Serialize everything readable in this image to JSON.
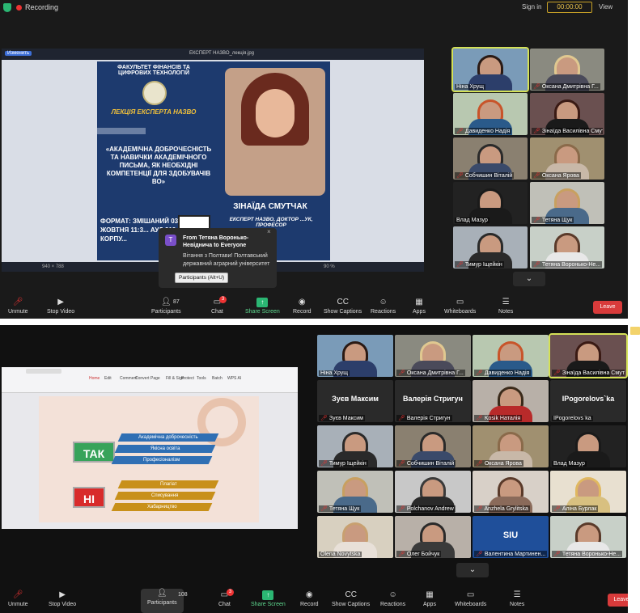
{
  "top": {
    "recording": "Recording",
    "signin": "Sign in",
    "timer": "00:00:00",
    "view": "View"
  },
  "viewer": {
    "filename": "ЕКСПЕРТ НАЗВО_лекція.jpg",
    "edit_button": "Изменить",
    "zoom": "90 %",
    "size_info": "940 × 788"
  },
  "poster": {
    "faculty": "ФАКУЛЬТЕТ ФІНАНСІВ ТА ЦИФРОВИХ ТЕХНОЛОГІЙ",
    "lecture": "ЛЕКЦІЯ ЕКСПЕРТА НАЗВО",
    "title": "«АКАДЕМІЧНА ДОБРОЧЕСНІСТЬ ТА НАВИЧКИ АКАДЕМІЧНОГО ПИСЬМА, ЯК НЕОБХІДНІ КОМПЕТЕНЦІЇ ДЛЯ ЗДОБУВАЧІВ ВО»",
    "speaker": "ЗІНАЇДА СМУТЧАК",
    "expert": "ЕКСПЕРТ НАЗВО, ДОКТОР ...УК, ПРОФЕСОР",
    "format": "ФОРМАТ: ЗМІШАНИЙ 03 ЖОВТНЯ 11:3... АУД 312, КОРПУ..."
  },
  "chat_popup": {
    "avatar": "T",
    "from": "From Тетяна Воронько-Невіднича to Everyone",
    "message": "Вітання з Полтави! Полтавський державний аграрний університет"
  },
  "gallery1": [
    {
      "name": "Ніна Хрущ",
      "muted": false,
      "hair": "#2a1a14",
      "body": "#2c3e6a",
      "bg": "#7a9bb8"
    },
    {
      "name": "Оксана Дмитрівна Г...",
      "muted": true,
      "hair": "#e0c890",
      "body": "#4a4a5a",
      "bg": "#8a8a80"
    },
    {
      "name": "Давиденко Надія",
      "muted": true,
      "hair": "#c8542a",
      "body": "#2a5a8a",
      "bg": "#b8c8b0"
    },
    {
      "name": "Зінаїда Василівна Смутч...",
      "muted": true,
      "hair": "#3a1a14",
      "body": "#1a1a1a",
      "bg": "#6a5050"
    },
    {
      "name": "Собчишин Віталій",
      "muted": true,
      "hair": "#2a2a2a",
      "body": "#3a4a6a",
      "bg": "#8a8070"
    },
    {
      "name": "Оксана Ярова",
      "muted": true,
      "hair": "#8a6a4a",
      "body": "#c8b8a8",
      "bg": "#a09070"
    },
    {
      "name": "Влад Мазур",
      "muted": false,
      "hair": "#1a1a1a",
      "body": "#1a1a1a",
      "bg": "#222222"
    },
    {
      "name": "Тетяна Щук",
      "muted": true,
      "hair": "#c8a060",
      "body": "#4a6a8a",
      "bg": "#c0c0b8"
    },
    {
      "name": "Тимур Іщейкін",
      "muted": true,
      "hair": "#2a2a2a",
      "body": "#2a2a2a",
      "bg": "#a8b0b8"
    },
    {
      "name": "Тетяна Воронько-Не...",
      "muted": true,
      "hair": "#5a3a2a",
      "body": "#e8e8e8",
      "bg": "#c8d0c8"
    }
  ],
  "gallery2": [
    {
      "name": "Ніна Хрущ",
      "muted": false,
      "hair": "#2a1a14",
      "body": "#2c3e6a",
      "bg": "#7a9bb8"
    },
    {
      "name": "Оксана Дмитрівна Г...",
      "muted": true,
      "hair": "#e0c890",
      "body": "#4a4a5a",
      "bg": "#8a8a80"
    },
    {
      "name": "Давиденко Надія",
      "muted": true,
      "hair": "#c8542a",
      "body": "#2a5a8a",
      "bg": "#b8c8b0"
    },
    {
      "name": "Зінаїда Василівна Смутч...",
      "muted": true,
      "hair": "#3a1a14",
      "body": "#1a1a1a",
      "bg": "#6a5050",
      "selected": true
    },
    {
      "name": "Зуєв Максим",
      "muted": true,
      "big": "Зуєв Максим"
    },
    {
      "name": "Валерія Стригун",
      "muted": true,
      "big": "Валерія Стригун"
    },
    {
      "name": "Kosik Наталія",
      "muted": true,
      "hair": "#3a2a1a",
      "body": "#b82a2a",
      "bg": "#b8b0a8"
    },
    {
      "name": "IPogorelovs`ka",
      "muted": false,
      "big": "IPogorelovs`ka"
    },
    {
      "name": "Тимур Іщейкін",
      "muted": true,
      "hair": "#2a2a2a",
      "body": "#2a2a2a",
      "bg": "#a8b0b8"
    },
    {
      "name": "Собчишин Віталій",
      "muted": true,
      "hair": "#2a2a2a",
      "body": "#3a4a6a",
      "bg": "#8a8070"
    },
    {
      "name": "Оксана Ярова",
      "muted": true,
      "hair": "#8a6a4a",
      "body": "#c8b8a8",
      "bg": "#a09070"
    },
    {
      "name": "Влад Мазур",
      "muted": false,
      "hair": "#1a1a1a",
      "body": "#1a1a1a",
      "bg": "#222222"
    },
    {
      "name": "Тетяна Щук",
      "muted": true,
      "hair": "#c8a060",
      "body": "#4a6a8a",
      "bg": "#c0c0b8"
    },
    {
      "name": "Polchanov Andrew",
      "muted": true,
      "hair": "#3a3a3a",
      "body": "#2a2a2a",
      "bg": "#c8c8c8"
    },
    {
      "name": "Anzhela Grylitska",
      "muted": true,
      "hair": "#5a3a2a",
      "body": "#8a6a5a",
      "bg": "#d8d0c8"
    },
    {
      "name": "Аліна Бурлак",
      "muted": true,
      "hair": "#e0b860",
      "body": "#d8c080",
      "bg": "#e8e0d0"
    },
    {
      "name": "Olena Novytska",
      "muted": false,
      "hair": "#c8a070",
      "body": "#e8e0d8",
      "bg": "#d8d0c0"
    },
    {
      "name": "Олег Бойчук",
      "muted": true,
      "hair": "#2a2a2a",
      "body": "#3a3a3a",
      "bg": "#b8b0a8"
    },
    {
      "name": "Валентина Мартинен...",
      "muted": true,
      "hair": "#1a3a7a",
      "body": "#1a3a7a",
      "bg": "#1f4f9a",
      "logo": "SIU"
    },
    {
      "name": "Тетяна Воронько-Не...",
      "muted": true,
      "hair": "#5a3a2a",
      "body": "#e8e8e8",
      "bg": "#c8d0c8"
    }
  ],
  "toolbar1": {
    "unmute": "Unmute",
    "stop_video": "Stop Video",
    "participants": "Participants",
    "participants_count": "87",
    "chat": "Chat",
    "chat_badge": "3",
    "share": "Share Screen",
    "record": "Record",
    "captions": "Show Captions",
    "reactions": "Reactions",
    "apps": "Apps",
    "whiteboards": "Whiteboards",
    "notes": "Notes",
    "leave": "Leave"
  },
  "toolbar2": {
    "unmute": "Unmute",
    "stop_video": "Stop Video",
    "participants": "Participants",
    "participants_count": "108",
    "chat": "Chat",
    "chat_badge": "3",
    "share": "Share Screen",
    "record": "Record",
    "captions": "Show Captions",
    "reactions": "Reactions",
    "apps": "Apps",
    "whiteboards": "Whiteboards",
    "notes": "Notes",
    "leave": "Leave",
    "tooltip": "Participants (Alt+U)"
  },
  "slide": {
    "tak": "ТАК",
    "ni": "НІ",
    "tak_items": [
      "Академічна доброчесність",
      "Якісна освіта",
      "Професіоналізм"
    ],
    "ni_items": [
      "Плагіат",
      "Списування",
      "Хабарництво"
    ],
    "menu": [
      "Home",
      "Edit",
      "Comment",
      "Convert",
      "Page",
      "Fill & Sign",
      "Protect",
      "Tools",
      "Batch",
      "WPS AI"
    ]
  },
  "colors": {
    "accent_green": "#2bb673",
    "leave_red": "#d83b3b",
    "selected": "#d4e157"
  }
}
